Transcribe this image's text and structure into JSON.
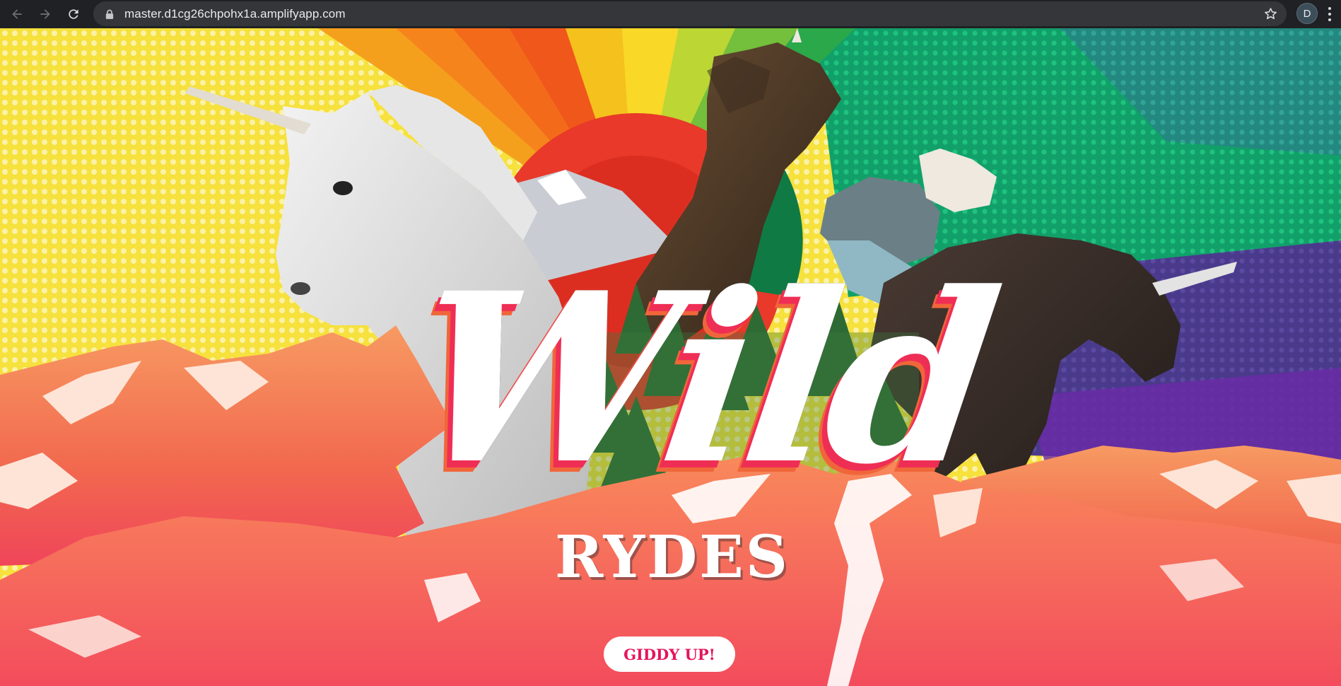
{
  "browser": {
    "url": "master.d1cg26chpohx1a.amplifyapp.com",
    "profile_initial": "D",
    "icons": [
      "back-icon",
      "forward-icon",
      "reload-icon",
      "lock-icon",
      "star-icon",
      "more-vert-icon"
    ]
  },
  "hero": {
    "title": "Wild",
    "subtitle": "RYDES",
    "cta_label": "GIDDY UP!"
  },
  "colors": {
    "cta_text": "#e5145b",
    "mountains": "#f26a4a",
    "yellow": "#f6e13d",
    "green": "#1aa86b",
    "purple": "#5a2d8c"
  }
}
